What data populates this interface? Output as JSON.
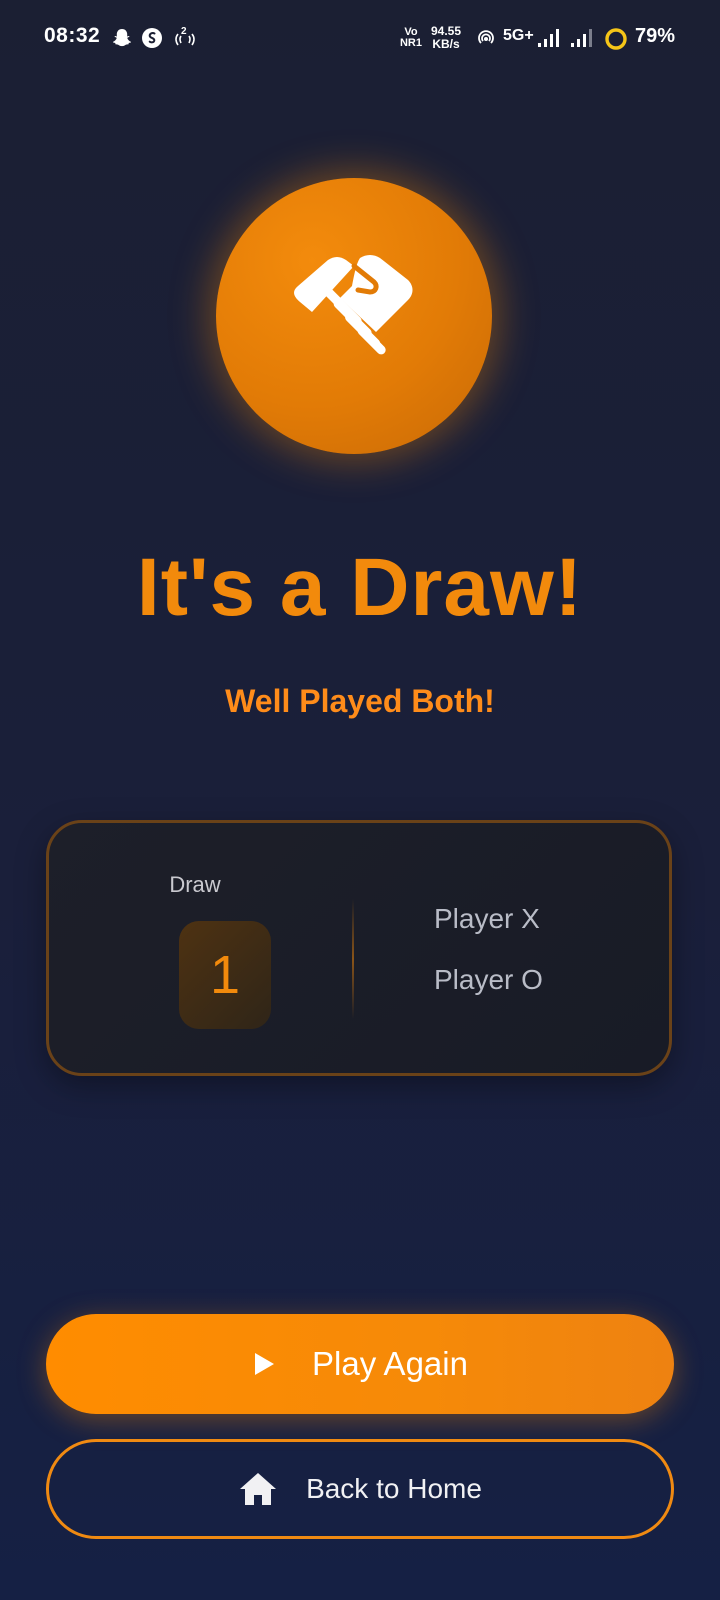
{
  "status_bar": {
    "time": "08:32",
    "left_icons": [
      "snapchat-icon",
      "shazam-icon",
      "hotspot-icon"
    ],
    "hotspot_count": "2",
    "network_label_top": "Vo",
    "network_label_bottom": "NR1",
    "speed_value": "94.55",
    "speed_unit": "KB/s",
    "network_type": "5G+",
    "battery": "79%",
    "colors": {
      "battery_ring": "#f5c518"
    }
  },
  "result": {
    "icon": "handshake-icon",
    "title": "It's a Draw!",
    "subtitle": "Well Played Both!"
  },
  "score_card": {
    "draw_label": "Draw",
    "draw_count": "1",
    "players": [
      "Player X",
      "Player O"
    ]
  },
  "actions": {
    "play_again_label": "Play Again",
    "play_icon": "play-icon",
    "back_home_label": "Back to Home",
    "home_icon": "home-icon"
  },
  "colors": {
    "accent": "#f28a0c",
    "background": "#1b1f33",
    "card_border": "#6a4218"
  }
}
